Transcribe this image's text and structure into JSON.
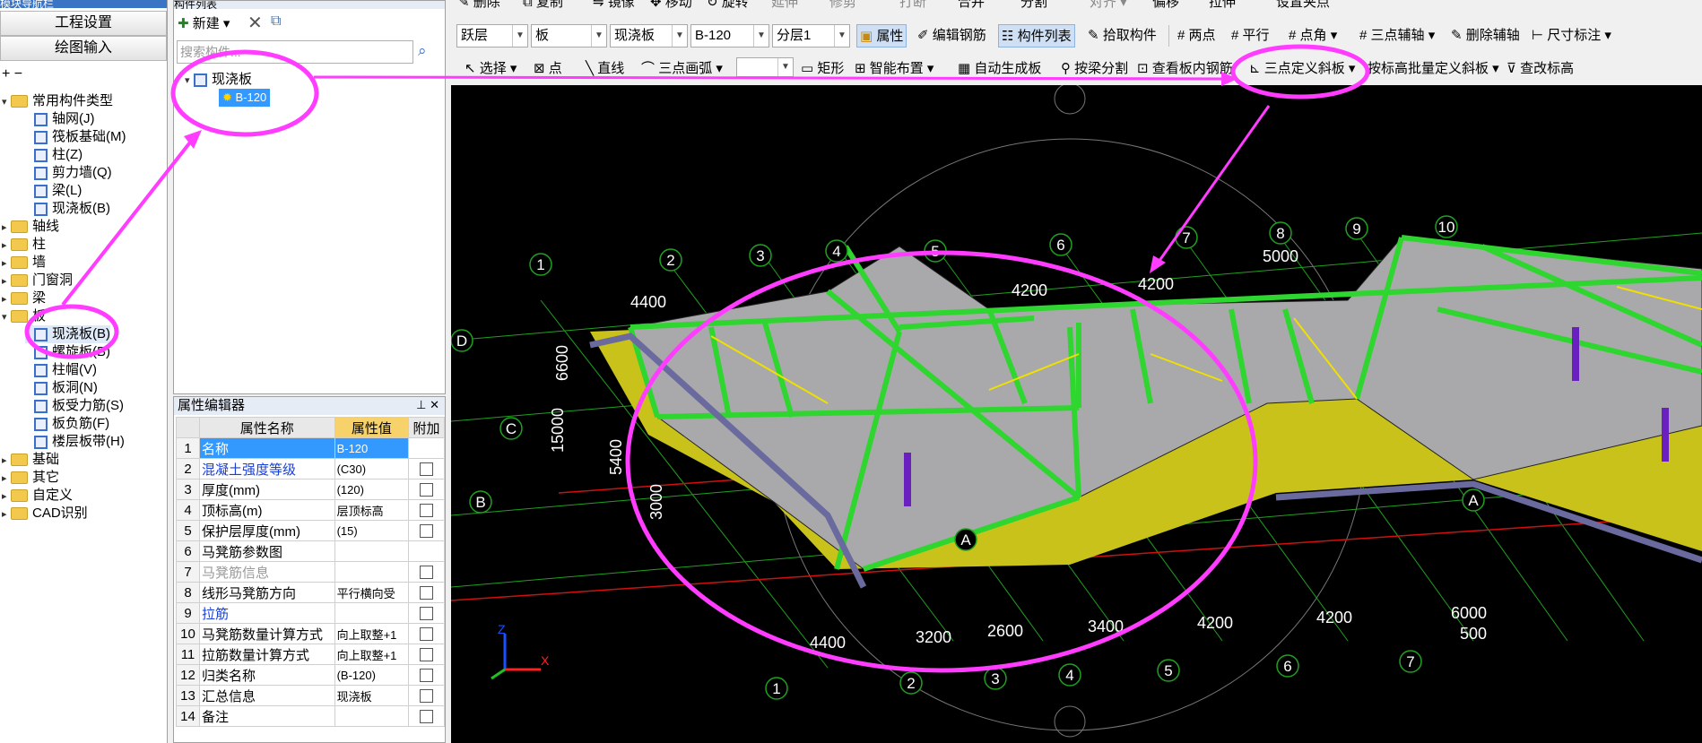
{
  "nav": {
    "header": "模块导航栏",
    "btn_settings": "工程设置",
    "btn_draw": "绘图输入",
    "tree": [
      {
        "label": "常用构件类型",
        "level": 0,
        "folder": true,
        "expanded": true
      },
      {
        "label": "轴网(J)",
        "level": 1
      },
      {
        "label": "筏板基础(M)",
        "level": 1
      },
      {
        "label": "柱(Z)",
        "level": 1
      },
      {
        "label": "剪力墙(Q)",
        "level": 1
      },
      {
        "label": "梁(L)",
        "level": 1
      },
      {
        "label": "现浇板(B)",
        "level": 1
      },
      {
        "label": "轴线",
        "level": 0,
        "folder": true
      },
      {
        "label": "柱",
        "level": 0,
        "folder": true
      },
      {
        "label": "墙",
        "level": 0,
        "folder": true
      },
      {
        "label": "门窗洞",
        "level": 0,
        "folder": true
      },
      {
        "label": "梁",
        "level": 0,
        "folder": true
      },
      {
        "label": "板",
        "level": 0,
        "folder": true,
        "expanded": true
      },
      {
        "label": "现浇板(B)",
        "level": 1,
        "selected": true
      },
      {
        "label": "螺旋板(B)",
        "level": 1
      },
      {
        "label": "柱帽(V)",
        "level": 1
      },
      {
        "label": "板洞(N)",
        "level": 1
      },
      {
        "label": "板受力筋(S)",
        "level": 1
      },
      {
        "label": "板负筋(F)",
        "level": 1
      },
      {
        "label": "楼层板带(H)",
        "level": 1
      },
      {
        "label": "基础",
        "level": 0,
        "folder": true
      },
      {
        "label": "其它",
        "level": 0,
        "folder": true
      },
      {
        "label": "自定义",
        "level": 0,
        "folder": true
      },
      {
        "label": "CAD识别",
        "level": 0,
        "folder": true
      }
    ]
  },
  "component_list": {
    "title": "构件列表",
    "new_label": "新建",
    "search_placeholder": "搜索构件...",
    "root": "现浇板",
    "child": "B-120"
  },
  "property_editor": {
    "title": "属性编辑器",
    "col_name": "属性名称",
    "col_value": "属性值",
    "col_extra": "附加",
    "rows": [
      {
        "n": "1",
        "name": "名称",
        "value": "B-120",
        "check": false,
        "blue": false,
        "gray": false
      },
      {
        "n": "2",
        "name": "混凝土强度等级",
        "value": "(C30)",
        "check": true,
        "blue": true,
        "gray": false
      },
      {
        "n": "3",
        "name": "厚度(mm)",
        "value": "(120)",
        "check": true,
        "blue": false,
        "gray": false
      },
      {
        "n": "4",
        "name": "顶标高(m)",
        "value": "层顶标高",
        "check": true,
        "blue": false,
        "gray": false
      },
      {
        "n": "5",
        "name": "保护层厚度(mm)",
        "value": "(15)",
        "check": true,
        "blue": false,
        "gray": false
      },
      {
        "n": "6",
        "name": "马凳筋参数图",
        "value": "",
        "check": false,
        "blue": false,
        "gray": false
      },
      {
        "n": "7",
        "name": "马凳筋信息",
        "value": "",
        "check": true,
        "blue": false,
        "gray": true
      },
      {
        "n": "8",
        "name": "线形马凳筋方向",
        "value": "平行横向受",
        "check": true,
        "blue": false,
        "gray": false
      },
      {
        "n": "9",
        "name": "拉筋",
        "value": "",
        "check": true,
        "blue": true,
        "gray": false
      },
      {
        "n": "10",
        "name": "马凳筋数量计算方式",
        "value": "向上取整+1",
        "check": true,
        "blue": false,
        "gray": false
      },
      {
        "n": "11",
        "name": "拉筋数量计算方式",
        "value": "向上取整+1",
        "check": true,
        "blue": false,
        "gray": false
      },
      {
        "n": "12",
        "name": "归类名称",
        "value": "(B-120)",
        "check": true,
        "blue": false,
        "gray": false
      },
      {
        "n": "13",
        "name": "汇总信息",
        "value": "现浇板",
        "check": true,
        "blue": false,
        "gray": false
      },
      {
        "n": "14",
        "name": "备注",
        "value": "",
        "check": true,
        "blue": false,
        "gray": false
      }
    ]
  },
  "toolbar1": {
    "delete": "删除",
    "copy": "复制",
    "mirror": "镜像",
    "move": "移动",
    "rotate": "旋转",
    "extend": "延伸",
    "trim": "修剪",
    "break": "打断",
    "merge": "合并",
    "split": "分割",
    "align": "对齐",
    "offset": "偏移",
    "stretch": "拉伸",
    "set_grip": "设置夹点"
  },
  "toolbar2": {
    "floor": "跃层",
    "type": "板",
    "subtype": "现浇板",
    "component": "B-120",
    "layer": "分层1",
    "property": "属性",
    "edit_rebar": "编辑钢筋",
    "component_list": "构件列表",
    "pick": "拾取构件",
    "two_point": "两点",
    "parallel": "平行",
    "point_angle": "点角",
    "three_point_aux": "三点辅轴",
    "delete_aux": "删除辅轴",
    "dimension": "尺寸标注"
  },
  "toolbar3": {
    "select": "选择",
    "point": "点",
    "line": "直线",
    "arc": "三点画弧",
    "rect": "矩形",
    "smart": "智能布置",
    "auto_gen": "自动生成板",
    "split_by_beam": "按梁分割",
    "view_rebar": "查看板内钢筋",
    "three_point_slope": "三点定义斜板",
    "batch_slope": "按标高批量定义斜板",
    "modify_elev": "查改标高"
  },
  "viewport": {
    "axes_num": [
      "1",
      "2",
      "3",
      "4",
      "5",
      "6",
      "7",
      "8",
      "9",
      "10"
    ],
    "axes_letter": [
      "A",
      "B",
      "C",
      "D"
    ],
    "dims": [
      "4400",
      "4200",
      "4200",
      "5000",
      "6600",
      "15000",
      "5400",
      "3000",
      "4400",
      "3200",
      "2600",
      "3400",
      "4200",
      "4200",
      "6000",
      "500"
    ],
    "bottom_nums": [
      "1",
      "2",
      "3",
      "4",
      "5",
      "6",
      "7"
    ],
    "axis_x_label": "X",
    "axis_z_label": "Z"
  },
  "colors": {
    "highlight": "#ff3cff",
    "slab_top": "#a9a9ab",
    "slab_edge": "#c8c21a",
    "beam": "#2fd62f",
    "beam_dark": "#6b6a9e",
    "grid": "#20a020",
    "red_line": "#d01010",
    "ui_accent": "#3a74c5"
  }
}
